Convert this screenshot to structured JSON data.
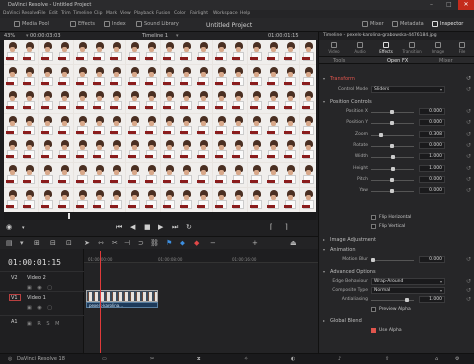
{
  "window": {
    "title": "DaVinci Resolve - Untitled Project",
    "minimize": "–",
    "maximize": "□",
    "close": "✕"
  },
  "menu": [
    "DaVinci Resolve",
    "File",
    "Edit",
    "Trim",
    "Timeline",
    "Clip",
    "Mark",
    "View",
    "Playback",
    "Fusion",
    "Color",
    "Fairlight",
    "Workspace",
    "Help"
  ],
  "toolbar": {
    "media_pool": "Media Pool",
    "effects": "Effects",
    "index": "Index",
    "sound_library": "Sound Library",
    "project_title": "Untitled Project",
    "mixer": "Mixer",
    "metadata": "Metadata",
    "inspector": "Inspector"
  },
  "viewer": {
    "zoom": "43%",
    "source_tc": "00:00:03:03",
    "timeline_name": "Timeline 1",
    "record_tc": "01:00:01:15"
  },
  "timeline": {
    "timecode": "01:00:01:15",
    "ruler": [
      "01:00:00:00",
      "01:00:08:00",
      "01:00:16:00"
    ],
    "tracks": [
      {
        "id": "V2",
        "name": "Video 2"
      },
      {
        "id": "V1",
        "name": "Video 1"
      },
      {
        "id": "A1",
        "name": ""
      }
    ],
    "clip_label": "pexels-karolina..."
  },
  "inspector": {
    "clip_name": "Timeline - pexels-karolina-grabowska-4476184.jpg",
    "tabs": [
      "Video",
      "Audio",
      "Effects",
      "Transition",
      "Image",
      "File"
    ],
    "active_tab": "Effects",
    "subtabs": [
      "Tools",
      "Open FX",
      "Mixer"
    ],
    "sections": {
      "transform": "Transform",
      "position_controls": "Position Controls",
      "image_adjustment": "Image Adjustment",
      "animation": "Animation",
      "advanced_options": "Advanced Options",
      "global_blend": "Global Blend"
    },
    "control_mode_label": "Control Mode",
    "control_mode": "Sliders",
    "params": [
      {
        "label": "Position X",
        "value": "0.000"
      },
      {
        "label": "Position Y",
        "value": "0.000"
      },
      {
        "label": "Zoom",
        "value": "0.308"
      },
      {
        "label": "Rotate",
        "value": "0.000"
      },
      {
        "label": "Width",
        "value": "1.000"
      },
      {
        "label": "Height",
        "value": "1.000"
      },
      {
        "label": "Pitch",
        "value": "0.000"
      },
      {
        "label": "Yaw",
        "value": "0.000"
      }
    ],
    "flip_h": "Flip Horizontal",
    "flip_v": "Flip Vertical",
    "motion_blur_label": "Motion Blur",
    "motion_blur": "0.000",
    "edge_behaviour_label": "Edge Behaviour",
    "edge_behaviour": "Wrap-Around",
    "composite_type_label": "Composite Type",
    "composite_type": "Normal",
    "antialiasing_label": "Antialiasing",
    "antialiasing": "1.000",
    "preview_alpha": "Preview Alpha",
    "use_alpha": "Use Alpha"
  },
  "bottom": {
    "app": "DaVinci Resolve 18"
  }
}
